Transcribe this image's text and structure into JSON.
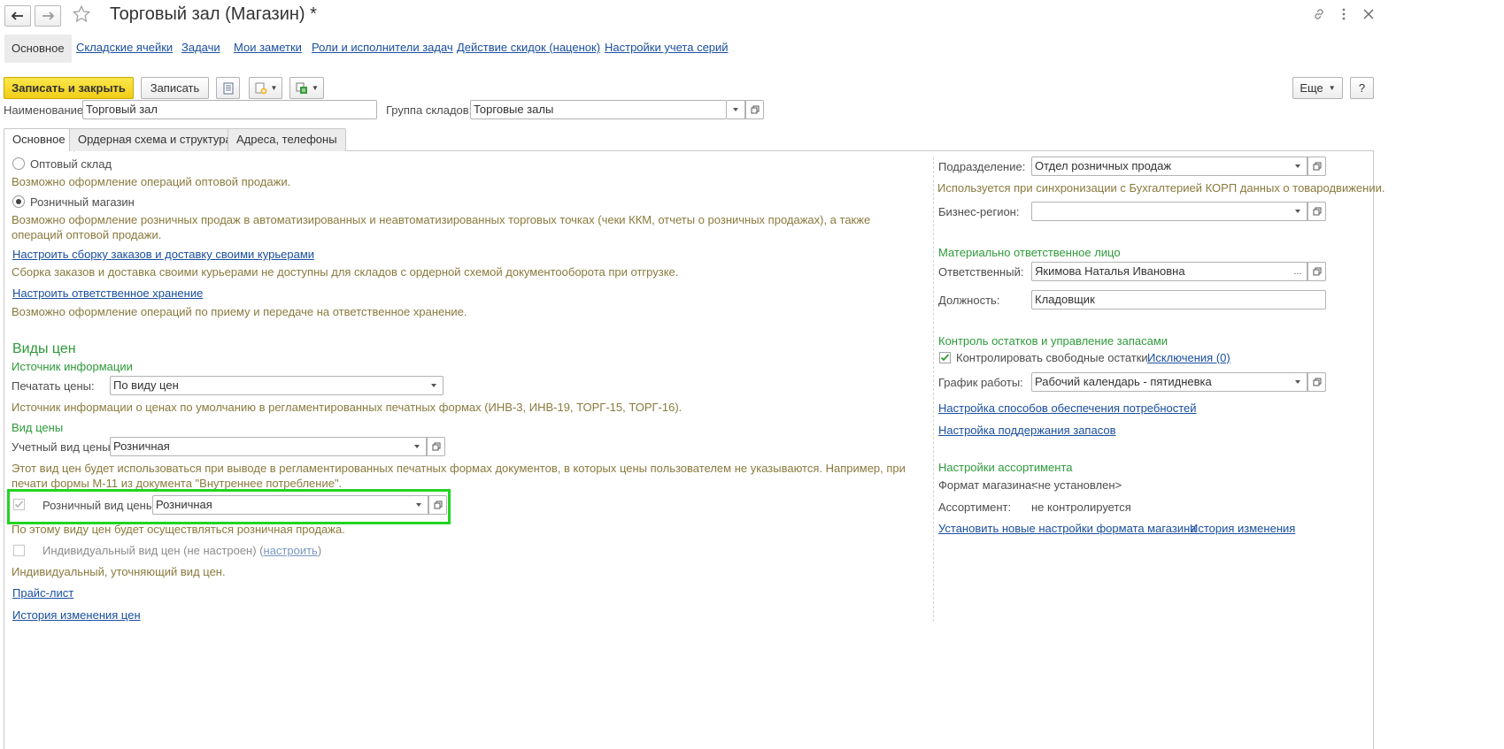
{
  "header": {
    "title": "Торговый зал (Магазин) *"
  },
  "nav_tabs": [
    {
      "label": "Основное",
      "active": true
    },
    {
      "label": "Складские ячейки"
    },
    {
      "label": "Задачи"
    },
    {
      "label": "Мои заметки"
    },
    {
      "label": "Роли и исполнители задач"
    },
    {
      "label": "Действие скидок (наценок)"
    },
    {
      "label": "Настройки учета серий"
    }
  ],
  "toolbar": {
    "save_close": "Записать и закрыть",
    "save": "Записать",
    "more": "Еще",
    "help": "?"
  },
  "form": {
    "name_label": "Наименование:",
    "name_value": "Торговый зал",
    "group_label": "Группа складов:",
    "group_value": "Торговые залы"
  },
  "inner_tabs": [
    {
      "label": "Основное",
      "active": true
    },
    {
      "label": "Ордерная схема и структура"
    },
    {
      "label": "Адреса, телефоны"
    }
  ],
  "left": {
    "wholesale_label": "Оптовый склад",
    "wholesale_hint": "Возможно оформление операций оптовой продажи.",
    "retail_label": "Розничный магазин",
    "retail_hint": "Возможно оформление розничных продаж в автоматизированных и неавтоматизированных торговых точках (чеки ККМ, отчеты о розничных продажах), а также операций оптовой продажи.",
    "courier_link": "Настроить сборку заказов и доставку своими курьерами",
    "courier_hint": "Сборка заказов и доставка своими курьерами не доступны для складов с ордерной схемой документооборота при отгрузке.",
    "storage_link": "Настроить ответственное хранение",
    "storage_hint": "Возможно оформление операций по приему и передаче на ответственное хранение.",
    "prices_heading": "Виды цен",
    "info_source_heading": "Источник информации",
    "print_prices_label": "Печатать цены:",
    "print_prices_value": "По виду цен",
    "print_prices_hint": "Источник информации о ценах по умолчанию в регламентированных печатных формах (ИНВ-3, ИНВ-19, ТОРГ-15, ТОРГ-16).",
    "price_type_heading": "Вид цены",
    "account_price_label": "Учетный вид цены:",
    "account_price_value": "Розничная",
    "account_price_hint": "Этот вид цен будет использоваться при выводе в регламентированных печатных формах документов, в которых цены пользователем не указываются. Например, при печати формы М-11 из документа \"Внутреннее потребление\".",
    "retail_price_label": "Розничный вид цены:",
    "retail_price_value": "Розничная",
    "retail_price_hint": "По этому виду цен будет осуществляться розничная продажа.",
    "individual_label": "Индивидуальный вид цен (не настроен) (",
    "individual_link": "настроить",
    "individual_close": ")",
    "individual_hint": "Индивидуальный, уточняющий вид цен.",
    "price_list_link": "Прайс-лист",
    "price_history_link": "История изменения цен"
  },
  "right": {
    "division_label": "Подразделение:",
    "division_value": "Отдел розничных продаж",
    "division_hint": "Используется при синхронизации с Бухгалтерией КОРП данных о товародвижении.",
    "region_label": "Бизнес-регион:",
    "region_value": "",
    "mol_heading": "Материально ответственное лицо",
    "responsible_label": "Ответственный:",
    "responsible_value": "Якимова Наталья Ивановна",
    "select_btn": "...",
    "position_label": "Должность:",
    "position_value": "Кладовщик",
    "stock_heading": "Контроль остатков и управление запасами",
    "control_label": "Контролировать свободные остатки",
    "exceptions_link": "Исключения (0)",
    "schedule_label": "График работы:",
    "schedule_value": "Рабочий календарь - пятидневка",
    "needs_link": "Настройка способов обеспечения потребностей",
    "stock_link": "Настройка поддержания запасов",
    "assortment_heading": "Настройки ассортимента",
    "format_label": "Формат магазина:",
    "format_value": "<не установлен>",
    "assortment_label": "Ассортимент:",
    "assortment_value": "не контролируется",
    "new_format_link": "Установить новые настройки формата магазина",
    "history_link": "История изменения"
  },
  "colors": {
    "accent_yellow": "#f4d31d",
    "section_green": "#2e9a3a",
    "link_blue": "#1a4fa0",
    "highlight_green": "#22d422"
  }
}
